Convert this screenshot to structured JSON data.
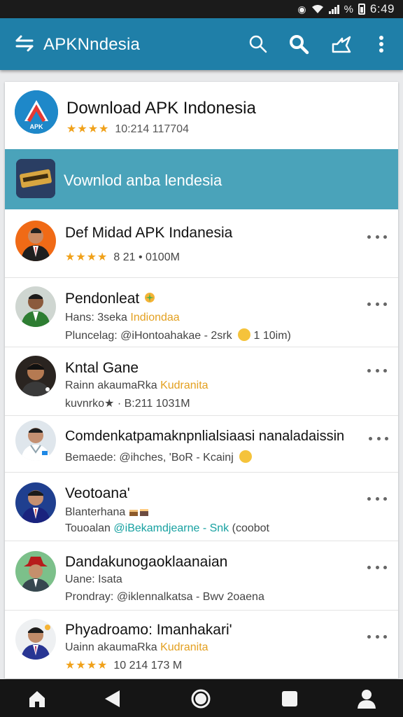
{
  "status_bar": {
    "percent": "%",
    "time": "6:49"
  },
  "app_bar": {
    "title": "APKNndesia"
  },
  "hero": {
    "logo_text": "APK",
    "title": "Download APK Indonesia",
    "stars": "★★★★",
    "meta": "10:214 117704"
  },
  "banner": {
    "text": "Vownlod anba lendesia"
  },
  "items": [
    {
      "name": "Def Midad APK  Indanesia",
      "stars": "★★★★",
      "meta": "8 21 • 0100M"
    },
    {
      "name": "Pendonleat",
      "line2_prefix": "Hans: 3seka",
      "line2_hl": "Indiondaa",
      "line3": "Pluncelag: @iHontoahakae - 2srk",
      "line3_tail": "1 10im)"
    },
    {
      "name": "Kntal Gane",
      "line2_prefix": "Rainn akaumaRka",
      "line2_hl": "Kudranita",
      "line3": "kuvnrko★ · B:211 1031M"
    },
    {
      "name": "Comdenkatpamaknpnlialsiaasi nanaladaissin",
      "line2_prefix": "Bemaede: @ihches, 'BoR - Kcainj"
    },
    {
      "name": "Veotoana'",
      "line2_prefix": "Blanterhana",
      "line3_prefix": "Touoalan",
      "line3_hl": "@iBekamdjearne - Snk",
      "line3_tail": "(coobot"
    },
    {
      "name": "Dandakunogaoklaanaian",
      "line2_prefix": "Uane: Isata",
      "line3": "Prondray: @iklennalkatsa - Bwv 2oaena"
    },
    {
      "name": "Phyadroamo: Imanhakari'",
      "line2_prefix": "Uainn akaumaRka",
      "line2_hl": "Kudranita",
      "stars": "★★★★",
      "meta": "10 214 173 M"
    }
  ],
  "colors": {
    "app_bar": "#1f7fa8",
    "banner": "#4aa3ba",
    "stars": "#f0a11a",
    "highlight_orange": "#e3a020",
    "highlight_teal": "#17a1a1"
  },
  "icons": [
    "back-arrow-icon",
    "search-icon",
    "search-bold-icon",
    "share-icon",
    "more-vert-icon",
    "home-icon",
    "nav-back-icon",
    "nav-home-circle-icon",
    "recents-icon",
    "profile-icon"
  ]
}
